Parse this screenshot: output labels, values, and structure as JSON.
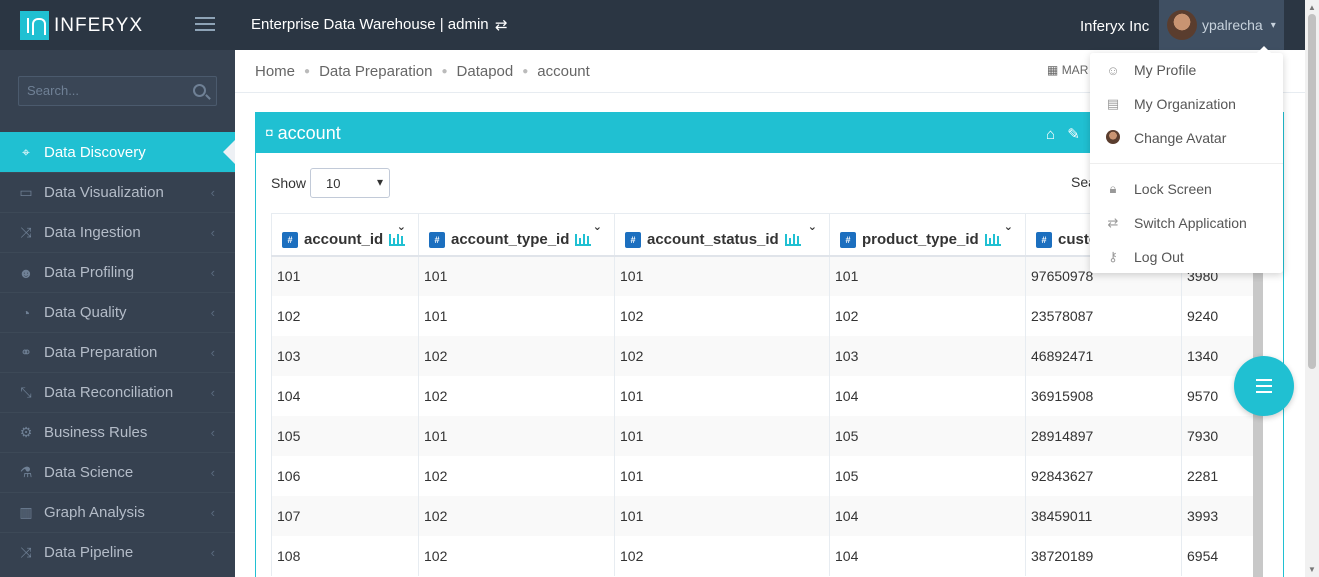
{
  "header": {
    "logo_text": "INFERYX",
    "app_title": "Enterprise Data Warehouse | admin",
    "switch_icon": "exchange-icon",
    "org_name": "Inferyx Inc",
    "user_name": "ypalrecha"
  },
  "sidebar": {
    "search_placeholder": "Search...",
    "items": [
      {
        "label": "Data Discovery",
        "icon": "binoculars-icon",
        "active": true
      },
      {
        "label": "Data Visualization",
        "icon": "monitor-icon"
      },
      {
        "label": "Data Ingestion",
        "icon": "shuffle-icon"
      },
      {
        "label": "Data Profiling",
        "icon": "users-icon"
      },
      {
        "label": "Data Quality",
        "icon": "rss-icon"
      },
      {
        "label": "Data Preparation",
        "icon": "link-icon"
      },
      {
        "label": "Data Reconciliation",
        "icon": "compress-icon"
      },
      {
        "label": "Business Rules",
        "icon": "gears-icon"
      },
      {
        "label": "Data Science",
        "icon": "flask-icon"
      },
      {
        "label": "Graph Analysis",
        "icon": "bar-chart-icon"
      },
      {
        "label": "Data Pipeline",
        "icon": "shuffle-icon"
      }
    ]
  },
  "breadcrumb": [
    "Home",
    "Data Preparation",
    "Datapod",
    "account"
  ],
  "date_label": "MAR",
  "portlet": {
    "title": "account",
    "show_label": "Show",
    "page_size": "10",
    "search_label": "Sea"
  },
  "table": {
    "columns": [
      "account_id",
      "account_type_id",
      "account_status_id",
      "product_type_id",
      "custo",
      ""
    ],
    "rows": [
      [
        "101",
        "101",
        "101",
        "101",
        "97650978",
        "3980"
      ],
      [
        "102",
        "101",
        "102",
        "102",
        "23578087",
        "9240"
      ],
      [
        "103",
        "102",
        "102",
        "103",
        "46892471",
        "1340"
      ],
      [
        "104",
        "102",
        "101",
        "104",
        "36915908",
        "9570"
      ],
      [
        "105",
        "101",
        "101",
        "105",
        "28914897",
        "7930"
      ],
      [
        "106",
        "102",
        "101",
        "105",
        "92843627",
        "2281"
      ],
      [
        "107",
        "102",
        "101",
        "104",
        "38459011",
        "3993"
      ],
      [
        "108",
        "102",
        "102",
        "104",
        "38720189",
        "6954"
      ]
    ]
  },
  "dropdown": {
    "items": [
      {
        "label": "My Profile",
        "icon": "user-icon"
      },
      {
        "label": "My Organization",
        "icon": "building-icon"
      },
      {
        "label": "Change Avatar",
        "icon": "avatar-icon"
      },
      {
        "label": "Lock Screen",
        "icon": "lock-icon"
      },
      {
        "label": "Switch Application",
        "icon": "exchange-icon"
      },
      {
        "label": "Log Out",
        "icon": "key-icon"
      }
    ]
  },
  "colors": {
    "accent": "#20c0d2",
    "header_bg": "#2b3643",
    "sidebar_bg": "#364150"
  }
}
